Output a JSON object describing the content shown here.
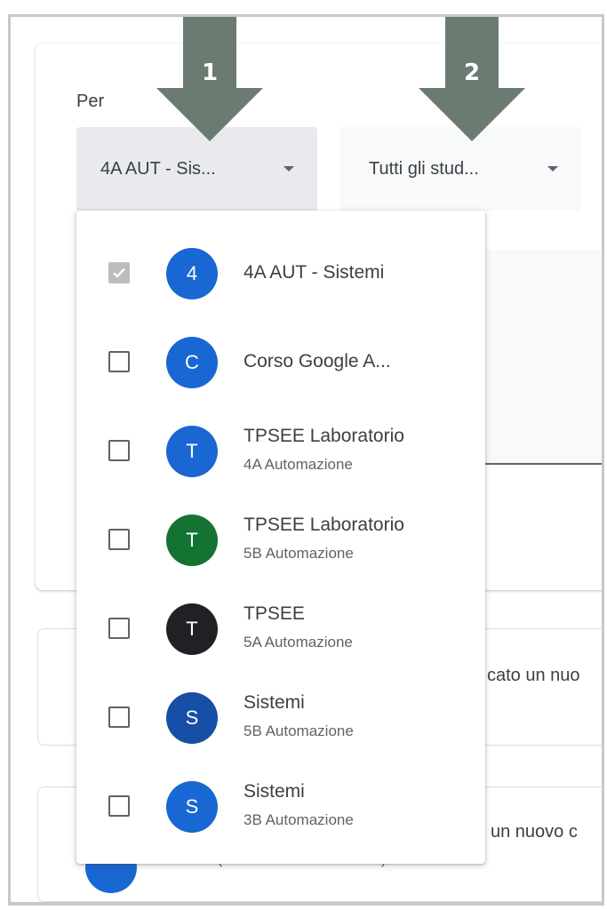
{
  "filters": {
    "per_label": "Per",
    "class_select_value": "4A AUT - Sis...",
    "student_select_value": "Tutti gli stud..."
  },
  "class_menu": [
    {
      "title": "4A AUT - Sistemi",
      "subtitle": "",
      "initial": "4",
      "color": "#1967d2",
      "checked": true
    },
    {
      "title": "Corso Google A...",
      "subtitle": "",
      "initial": "C",
      "color": "#1967d2",
      "checked": false
    },
    {
      "title": "TPSEE Laboratorio",
      "subtitle": "4A Automazione",
      "initial": "T",
      "color": "#1967d2",
      "checked": false
    },
    {
      "title": "TPSEE Laboratorio",
      "subtitle": "5B Automazione",
      "initial": "T",
      "color": "#137333",
      "checked": false
    },
    {
      "title": "TPSEE",
      "subtitle": "5A Automazione",
      "initial": "T",
      "color": "#202124",
      "checked": false
    },
    {
      "title": "Sistemi",
      "subtitle": "5B Automazione",
      "initial": "S",
      "color": "#174ea6",
      "checked": false
    },
    {
      "title": "Sistemi",
      "subtitle": "3B Automazione",
      "initial": "S",
      "color": "#1967d2",
      "checked": false
    }
  ],
  "background": {
    "card2_text": "cato un nuo",
    "card3_text": "un nuovo c",
    "card3_sub": "20 mar (Ultima modifica: 20 mar)"
  },
  "annotations": {
    "arrow_1_label": "1",
    "arrow_2_label": "2",
    "arrow_color": "#6b7b71"
  }
}
